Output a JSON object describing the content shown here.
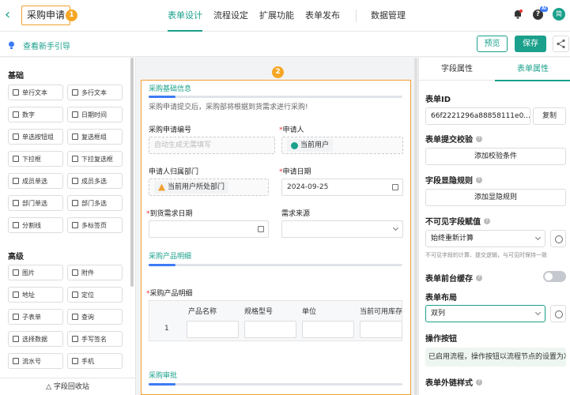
{
  "header": {
    "title": "采购申请",
    "badge1": "1",
    "badge2": "2",
    "tabs": [
      "表单设计",
      "流程设定",
      "扩展功能",
      "表单发布",
      "数据管理"
    ],
    "ai_tag": "AI",
    "avatar": "简"
  },
  "subbar": {
    "guide": "查看新手引导",
    "preview": "预览",
    "save": "保存"
  },
  "left_panel": {
    "basic_title": "基础",
    "basic_items": [
      "单行文本",
      "多行文本",
      "数字",
      "日期时间",
      "单选按钮组",
      "复选框组",
      "下拉框",
      "下拉复选框",
      "成员单选",
      "成员多选",
      "部门单选",
      "部门多选",
      "分割线",
      "多标签页"
    ],
    "advanced_title": "高级",
    "advanced_items": [
      "图片",
      "附件",
      "地址",
      "定位",
      "子表单",
      "查询",
      "选择数据",
      "手写签名",
      "流水号",
      "手机"
    ],
    "recycle": "字段回收站"
  },
  "canvas": {
    "section1": "采购基础信息",
    "hint": "采购申请提交后，采购部将根据到货需求进行采购!",
    "f_no_label": "采购申请编号",
    "f_no_placeholder": "自动生成无需填写",
    "f_applicant_label": "申请人",
    "f_applicant_value": "当前用户",
    "f_dept_label": "申请人归属部门",
    "f_dept_value": "当前用户所处部门",
    "f_date_label": "申请日期",
    "f_date_value": "2024-09-25",
    "f_arrive_label": "到货需求日期",
    "f_source_label": "需求来源",
    "section2": "采购产品明细",
    "table_label": "采购产品明细",
    "table_cols": [
      "产品名称",
      "规格型号",
      "单位",
      "当前可用库存"
    ],
    "row_index": "1",
    "section3": "采购审批",
    "req_mark": "*"
  },
  "right_panel": {
    "tab_field": "字段属性",
    "tab_form": "表单属性",
    "form_id_label": "表单ID",
    "form_id_value": "66f2221296a88858111e0...",
    "copy": "复制",
    "validate_label": "表单提交校验",
    "validate_btn": "添加校验条件",
    "visibility_label": "字段显隐规则",
    "visibility_btn": "添加显隐规则",
    "invisible_label": "不可见字段赋值",
    "invisible_value": "始终重新计算",
    "invisible_note": "不可见字段的计算、提交逻辑，与可见时保持一致",
    "cache_label": "表单前台缓存",
    "layout_label": "表单布局",
    "layout_value": "双列",
    "action_label": "操作按钮",
    "action_info": "已启用流程，操作按钮以流程节点的设置为准",
    "link_label": "表单外链样式"
  },
  "colors": {
    "accent": "#1aa08b",
    "highlight": "#f0a030",
    "progress": "#3c7bf6"
  },
  "icons": [
    "back-chevron-icon",
    "bell-icon",
    "help-icon",
    "lightbulb-icon",
    "share-icon",
    "calendar-icon",
    "user-icon",
    "org-icon",
    "gear-icon",
    "recycle-icon"
  ]
}
